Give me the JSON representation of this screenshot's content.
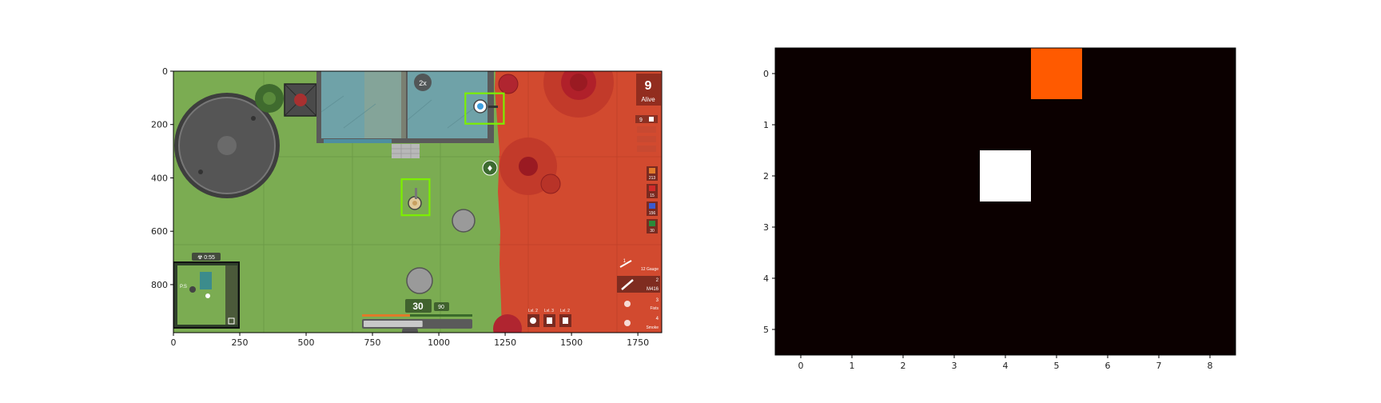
{
  "game_frame": {
    "title": "",
    "axes": {
      "x_ticks": [
        0,
        250,
        500,
        750,
        1000,
        1250,
        1500,
        1750
      ],
      "y_ticks": [
        0,
        200,
        400,
        600,
        800
      ],
      "xlim": [
        0,
        1840
      ],
      "ylim": [
        980,
        0
      ]
    },
    "hud": {
      "alive_count": "9",
      "alive_label": "Alive",
      "zoom": "2x",
      "minimap_label": "☢ 0:55",
      "ammo_loaded": "30",
      "ammo_reserve": "90",
      "gear_labels": [
        "Lvl. 2",
        "Lvl. 3",
        "Lvl. 2"
      ],
      "inventory_counts": [
        "9"
      ],
      "ammo_stacks": [
        "213",
        "15",
        "156",
        "30"
      ],
      "weapon_slots": [
        {
          "slot": "1",
          "name": "12 Gauge"
        },
        {
          "slot": "2",
          "name": "M416"
        },
        {
          "slot": "3",
          "name": "Fists"
        },
        {
          "slot": "4",
          "name": "Smoke"
        }
      ],
      "weapon_slot_active": 2,
      "health_fraction": 0.55
    },
    "detections": [
      {
        "label": "player",
        "x0": 860,
        "y0": 405,
        "x1": 965,
        "y1": 540
      },
      {
        "label": "player",
        "x0": 1100,
        "y0": 83,
        "x1": 1245,
        "y1": 197
      }
    ],
    "colors": {
      "grass": "#7bac52",
      "gas": "#d24a2f",
      "box": "#7cf000",
      "building_glass": "#6fa2a8"
    }
  },
  "chart_data": {
    "type": "heatmap",
    "rows": 6,
    "cols": 9,
    "x_ticks": [
      "0",
      "1",
      "2",
      "3",
      "4",
      "5",
      "6",
      "7",
      "8"
    ],
    "y_ticks": [
      "0",
      "1",
      "2",
      "3",
      "4",
      "5"
    ],
    "values": [
      [
        0,
        0,
        0,
        0,
        0,
        0.6,
        0,
        0,
        0
      ],
      [
        0,
        0,
        0,
        0,
        0,
        0,
        0,
        0,
        0
      ],
      [
        0,
        0,
        0,
        0,
        1,
        0,
        0,
        0,
        0
      ],
      [
        0,
        0,
        0,
        0,
        0,
        0,
        0,
        0,
        0
      ],
      [
        0,
        0,
        0,
        0,
        0,
        0,
        0,
        0,
        0
      ],
      [
        0,
        0,
        0,
        0,
        0,
        0,
        0,
        0,
        0
      ]
    ],
    "colormap": "hot",
    "cell_colors": {
      "low": "#0b0000",
      "mid": "#ff5a00",
      "high": "#ffffff"
    }
  }
}
